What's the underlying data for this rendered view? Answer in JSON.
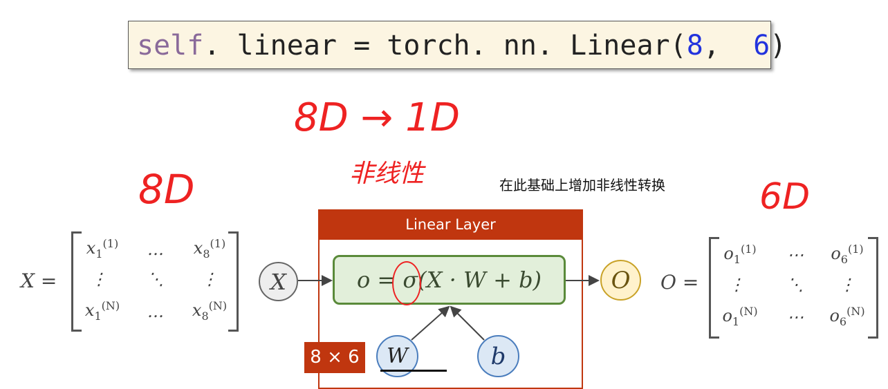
{
  "code": {
    "self": "self",
    "middle": ". linear = torch. nn. Linear(",
    "arg1": "8",
    "sep": ",  ",
    "arg2": "6",
    "close": ")"
  },
  "annotations": {
    "top": "8D → 1D",
    "nonlinear": "非线性",
    "left": "8D",
    "right": "6D",
    "circle_on": "σ"
  },
  "caption": "在此基础上增加非线性转换",
  "layer": {
    "title": "Linear Layer",
    "formula": "o = σ(X · W + b)",
    "shape_badge": "8 × 6"
  },
  "nodes": {
    "input": "X",
    "output": "O",
    "weight": "W",
    "bias": "b"
  },
  "input_matrix": {
    "lhs": "X =",
    "var": "x",
    "cols": [
      "1",
      "8"
    ],
    "rows": [
      "(1)",
      "(N)"
    ],
    "hdots": "…",
    "vdots": "⋮",
    "ddots": "⋱"
  },
  "output_matrix": {
    "lhs": "O =",
    "var": "o",
    "cols": [
      "1",
      "6"
    ],
    "rows": [
      "(1)",
      "(N)"
    ],
    "hdots": "⋯",
    "vdots": "⋮",
    "ddots": "⋱"
  },
  "colors": {
    "layer": "#c0360f",
    "formula_bg": "#e2efda",
    "annotation": "#ee2222"
  }
}
